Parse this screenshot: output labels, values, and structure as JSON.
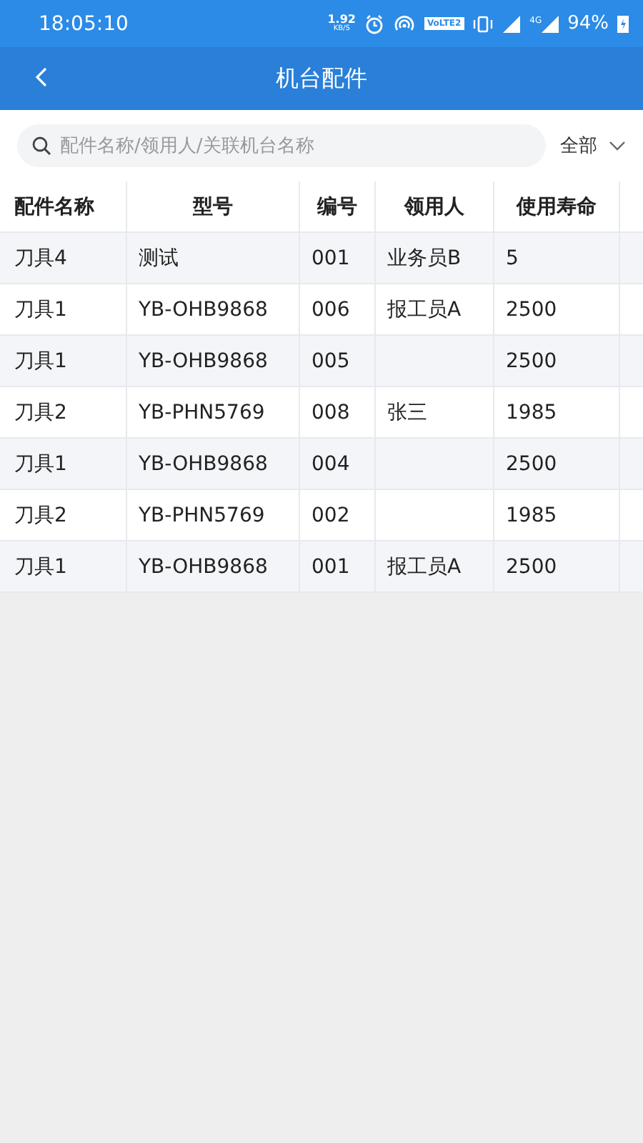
{
  "status_bar": {
    "time": "18:05:10",
    "speed": "1.92",
    "speed_unit": "KB/S",
    "volte": "VoLTE2",
    "network": "4G",
    "battery": "94%"
  },
  "header": {
    "title": "机台配件"
  },
  "search": {
    "placeholder": "配件名称/领用人/关联机台名称"
  },
  "filter": {
    "label": "全部"
  },
  "table": {
    "columns": [
      "配件名称",
      "型号",
      "编号",
      "领用人",
      "使用寿命"
    ],
    "rows": [
      [
        "刀具4",
        "测试",
        "001",
        "业务员B",
        "5"
      ],
      [
        "刀具1",
        "YB-OHB9868",
        "006",
        "报工员A",
        "2500"
      ],
      [
        "刀具1",
        "YB-OHB9868",
        "005",
        "",
        "2500"
      ],
      [
        "刀具2",
        "YB-PHN5769",
        "008",
        "张三",
        "1985"
      ],
      [
        "刀具1",
        "YB-OHB9868",
        "004",
        "",
        "2500"
      ],
      [
        "刀具2",
        "YB-PHN5769",
        "002",
        "",
        "1985"
      ],
      [
        "刀具1",
        "YB-OHB9868",
        "001",
        "报工员A",
        "2500"
      ]
    ]
  }
}
